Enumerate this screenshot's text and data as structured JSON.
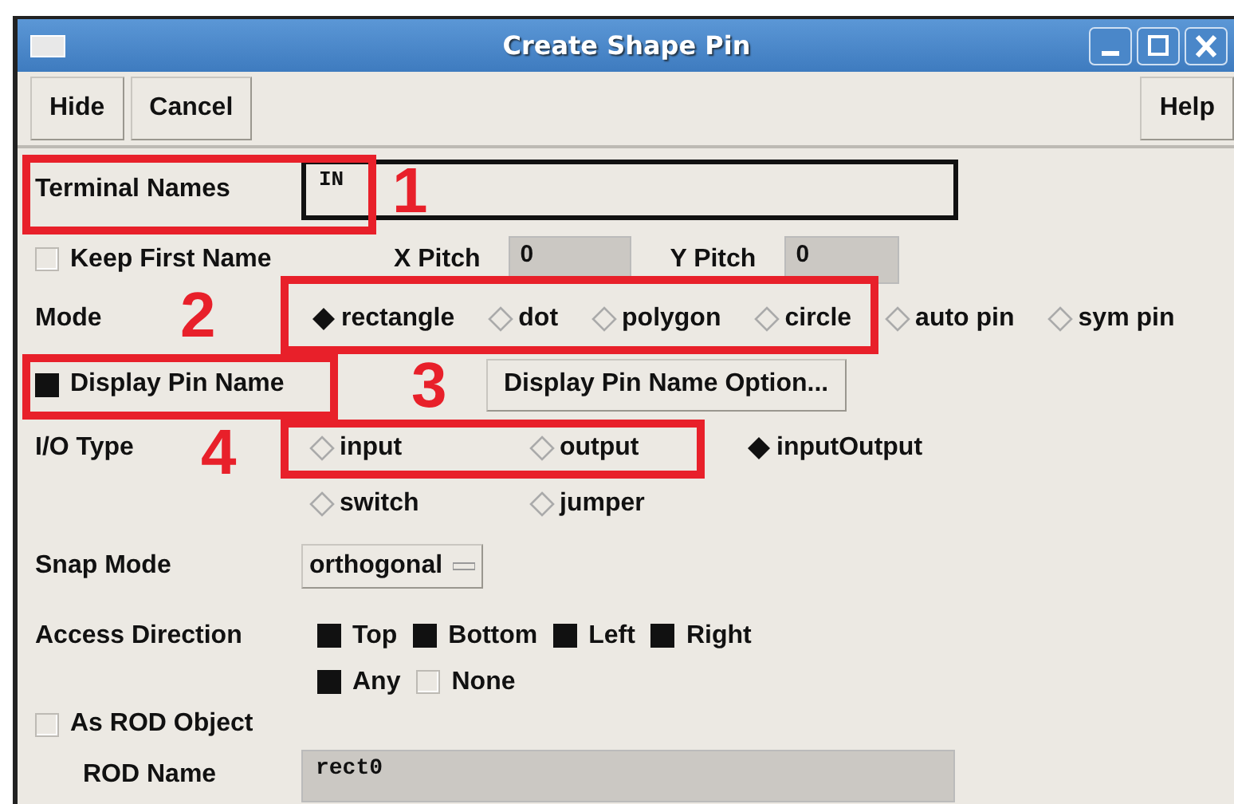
{
  "window": {
    "title": "Create Shape Pin"
  },
  "toolbar": {
    "buttons": [
      "Hide",
      "Cancel"
    ],
    "help": "Help"
  },
  "terminal_names": {
    "label": "Terminal Names",
    "value": "IN"
  },
  "keep_first_name": {
    "label": "Keep First Name",
    "checked": false
  },
  "x_pitch": {
    "label": "X Pitch",
    "value": "0"
  },
  "y_pitch": {
    "label": "Y Pitch",
    "value": "0"
  },
  "mode": {
    "label": "Mode",
    "options": [
      {
        "label": "rectangle",
        "selected": true
      },
      {
        "label": "dot",
        "selected": false
      },
      {
        "label": "polygon",
        "selected": false
      },
      {
        "label": "circle",
        "selected": false
      },
      {
        "label": "auto pin",
        "selected": false
      },
      {
        "label": "sym pin",
        "selected": false
      }
    ]
  },
  "display_pin_name": {
    "label": "Display Pin Name",
    "checked": true
  },
  "display_pin_name_option": "Display Pin Name Option...",
  "io_type": {
    "label": "I/O Type",
    "options": [
      {
        "label": "input",
        "selected": false
      },
      {
        "label": "output",
        "selected": false
      },
      {
        "label": "inputOutput",
        "selected": true
      },
      {
        "label": "switch",
        "selected": false
      },
      {
        "label": "jumper",
        "selected": false
      }
    ]
  },
  "snap_mode": {
    "label": "Snap Mode",
    "value": "orthogonal"
  },
  "access_direction": {
    "label": "Access Direction",
    "rows": [
      [
        {
          "label": "Top",
          "checked": true
        },
        {
          "label": "Bottom",
          "checked": true
        },
        {
          "label": "Left",
          "checked": true
        },
        {
          "label": "Right",
          "checked": true
        }
      ],
      [
        {
          "label": "Any",
          "checked": true
        },
        {
          "label": "None",
          "checked": false
        }
      ]
    ]
  },
  "as_rod_object": {
    "label": "As ROD Object",
    "checked": false
  },
  "rod_name": {
    "label": "ROD Name",
    "value": "rect0"
  },
  "annotations": [
    {
      "number": "1"
    },
    {
      "number": "2"
    },
    {
      "number": "3"
    },
    {
      "number": "4"
    }
  ]
}
